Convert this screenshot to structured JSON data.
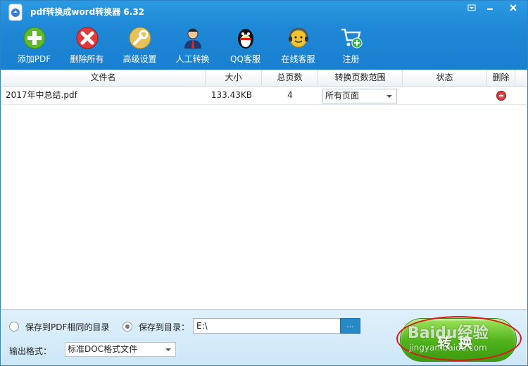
{
  "window": {
    "title": "pdf转换成word转换器 6.32",
    "controls": [
      "restore-icon",
      "minimize-icon",
      "close-icon"
    ]
  },
  "toolbar": {
    "items": [
      {
        "label": "添加PDF",
        "icon": "add-icon"
      },
      {
        "label": "删除所有",
        "icon": "delete-all-icon"
      },
      {
        "label": "高级设置",
        "icon": "wrench-icon"
      },
      {
        "label": "人工转换",
        "icon": "agent-icon"
      },
      {
        "label": "QQ客服",
        "icon": "qq-penguin-icon"
      },
      {
        "label": "在线客服",
        "icon": "headset-icon"
      },
      {
        "label": "注册",
        "icon": "cart-icon"
      }
    ]
  },
  "table": {
    "headers": [
      "文件名",
      "大小",
      "总页数",
      "转换页数范围",
      "状态",
      "删除"
    ],
    "rows": [
      {
        "filename": "2017年中总结.pdf",
        "size": "133.43KB",
        "pages": "4",
        "range": "所有页面",
        "status": ""
      }
    ]
  },
  "options": {
    "save_same_dir": "保存到PDF相同的目录",
    "save_to_dir": "保存到目录：",
    "save_mode": "save_to_dir",
    "output_path": "E:\\",
    "browse_label": "...",
    "output_format_label": "输出格式：",
    "output_format_value": "标准DOC格式文件"
  },
  "convert": {
    "label": "转换"
  },
  "watermark": {
    "brand": "Baidu经验",
    "url": "jingyan.baidu.com"
  },
  "colors": {
    "titlebar": "#1e88d6",
    "bottom_panel": "#d6ecfa",
    "convert_green": "#4db21b",
    "annotation_red": "#e0141b"
  }
}
